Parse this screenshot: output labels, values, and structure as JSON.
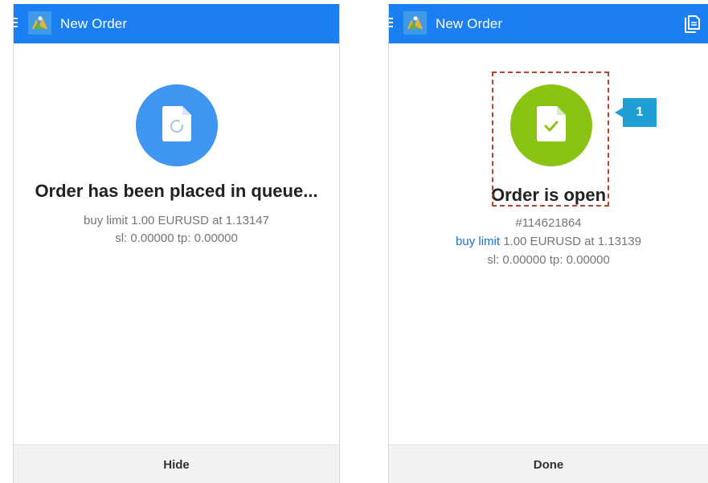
{
  "left_screen": {
    "header": {
      "title": "New Order"
    },
    "status": {
      "title": "Order has been placed in queue...",
      "details": "buy limit 1.00 EURUSD at 1.13147",
      "sl_tp": "sl: 0.00000 tp: 0.00000"
    },
    "button": {
      "label": "Hide"
    }
  },
  "right_screen": {
    "header": {
      "title": "New Order"
    },
    "status": {
      "title": "Order is open",
      "ticket": "#114621864",
      "order_type": "buy limit",
      "details": " 1.00 EURUSD at 1.13139",
      "sl_tp": "sl: 0.00000 tp: 0.00000"
    },
    "button": {
      "label": "Done"
    }
  },
  "annotation": {
    "callout": "1"
  },
  "icons": {
    "menu": "menu-icon",
    "app_logo": "metatrader-logo-icon",
    "copy": "copy-icon",
    "pending": "pending-document-icon",
    "open": "checked-document-icon"
  },
  "colors": {
    "appbar": "#1a7ff2",
    "pending_circle": "#3f96f0",
    "open_circle": "#8ac314",
    "link": "#1a73c9",
    "highlight": "#b6462f",
    "callout": "#1f9fd3"
  }
}
